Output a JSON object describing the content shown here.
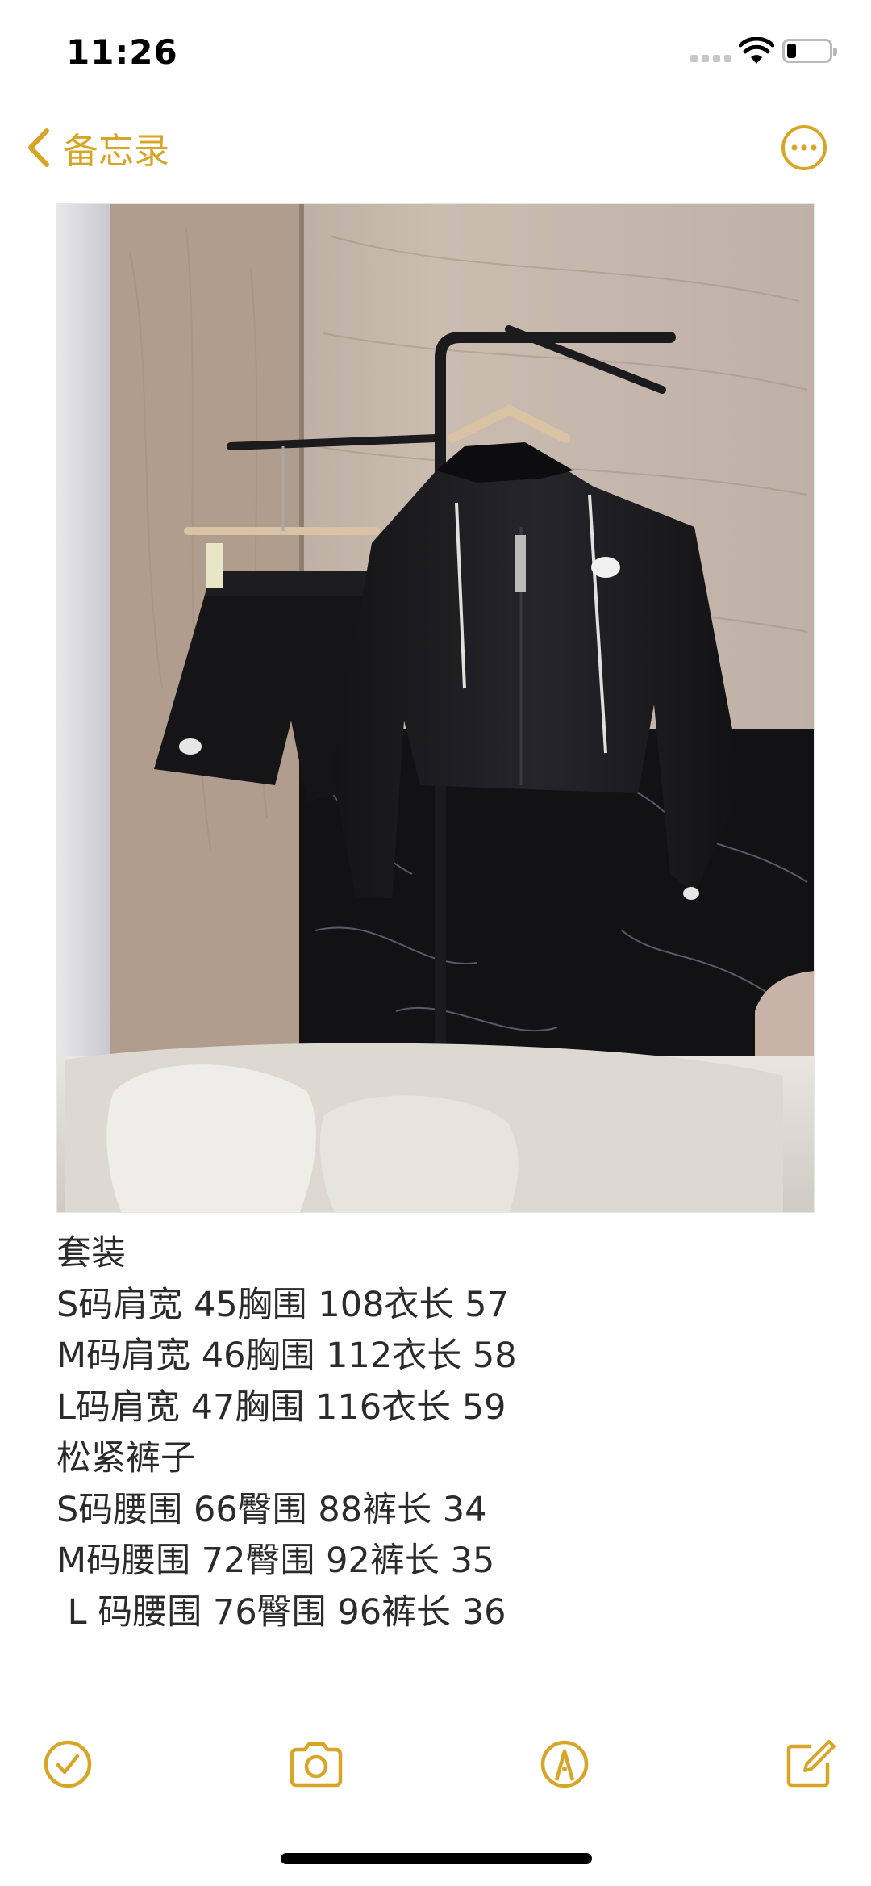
{
  "status_bar": {
    "time": "11:26",
    "battery_level_fraction": 0.22,
    "icons": [
      "signal-icon",
      "wifi-icon",
      "battery-icon"
    ]
  },
  "nav": {
    "back_label": "备忘录",
    "back_icon": "chevron-left-icon",
    "more_icon": "more-ellipsis-icon"
  },
  "note": {
    "lines": [
      "套装",
      "S码肩宽 45胸围 108衣长 57",
      "M码肩宽 46胸围 112衣长 58",
      "L码肩宽 47胸围 116衣长 59",
      "松紧裤子",
      "S码腰围 66臀围 88裤长 34",
      "M码腰围 72臀围 92裤长 35",
      " L 码腰围 76臀围 96裤长 36"
    ]
  },
  "toolbar": {
    "items": [
      "checklist-icon",
      "camera-icon",
      "markup-icon",
      "compose-icon"
    ]
  },
  "colors": {
    "accent": "#d8a527",
    "text": "#2b2b2b",
    "background": "#ffffff"
  }
}
